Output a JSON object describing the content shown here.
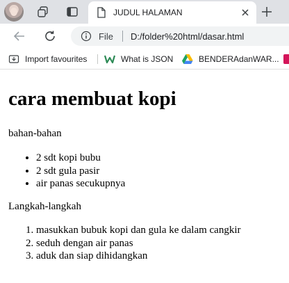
{
  "tab": {
    "title": "JUDUL HALAMAN"
  },
  "address": {
    "scheme_label": "File",
    "url": "D:/folder%20html/dasar.html"
  },
  "bookmarks": [
    {
      "label": "Import favourites",
      "icon": "import-icon"
    },
    {
      "label": "What is JSON",
      "icon": "w-favicon"
    },
    {
      "label": "BENDERAdanWAR...",
      "icon": "drive-icon"
    }
  ],
  "page": {
    "heading": "cara membuat kopi",
    "ingredients_label": "bahan-bahan",
    "ingredients": [
      "2 sdt kopi bubu",
      "2 sdt gula pasir",
      "air panas secukupnya"
    ],
    "steps_label": "Langkah-langkah",
    "steps": [
      "masukkan bubuk kopi dan gula ke dalam cangkir",
      "seduh dengan air panas",
      "aduk dan siap dihidangkan"
    ]
  }
}
